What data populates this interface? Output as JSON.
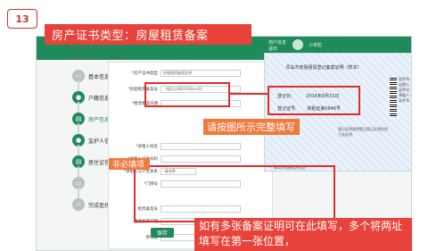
{
  "slide": {
    "number": "13",
    "title": "房产证书类型：房屋租赁备案",
    "callout_fill": "请按图所示完整填写",
    "callout_required": "非必填项",
    "note": "如有多张备案证明可在此填写，多个将两址填写在第一张位置，"
  },
  "app": {
    "user": "小米粒",
    "links": [
      "用户信息",
      "退出"
    ],
    "breadcrumb": [
      "信息填写",
      ">",
      "上传证件"
    ],
    "steps": [
      {
        "icon": "▭",
        "label": "基本信息"
      },
      {
        "icon": "●",
        "label": "户籍信息"
      },
      {
        "icon": "▤",
        "label": "房产信息"
      },
      {
        "icon": "●",
        "label": "监护人信息"
      },
      {
        "icon": "▤",
        "label": "居住证信息"
      },
      {
        "icon": "▭",
        "label": ""
      },
      {
        "icon": "✓",
        "label": "完成查找报"
      }
    ],
    "form": {
      "rows": [
        {
          "k": "*房产证书类型",
          "v": "房屋租赁备案证明"
        },
        {
          "k": "*房屋租赁备案号",
          "v": "（填写示例2016年xx号）"
        },
        {
          "k": "*租赁备案日期",
          "v": ""
        },
        {
          "k": "*承租人姓名",
          "v": ""
        },
        {
          "k": "*承租人证件号码",
          "v": ""
        },
        {
          "k": "*承租人与学生关系",
          "v": "-请选择-"
        },
        {
          "k": "*门牌号",
          "v": ""
        },
        {
          "k": "租赁备案号",
          "v": ""
        },
        {
          "k": "租赁备案日期",
          "v": ""
        },
        {
          "k": "原地址",
          "v": ""
        }
      ],
      "save_label": "保存"
    },
    "certificate": {
      "title": "青岛市房屋租赁登记备案证明（样本）",
      "reg_date_label": "登记日:",
      "reg_date": "2016年8月31日",
      "reg_no_label": "登记证号:",
      "reg_no": "房租证第0846号",
      "note": "登记证明表明登记登记证明仅用于此证明",
      "footer": "青岛市房屋租赁登记",
      "side_labels": [
        "证件号:",
        "出租人:",
        "证件号:",
        "承租人:",
        "证件号:"
      ]
    }
  },
  "colors": {
    "red": "#e8433a",
    "orange": "#f07a3e",
    "green": "#1f8a5b"
  }
}
